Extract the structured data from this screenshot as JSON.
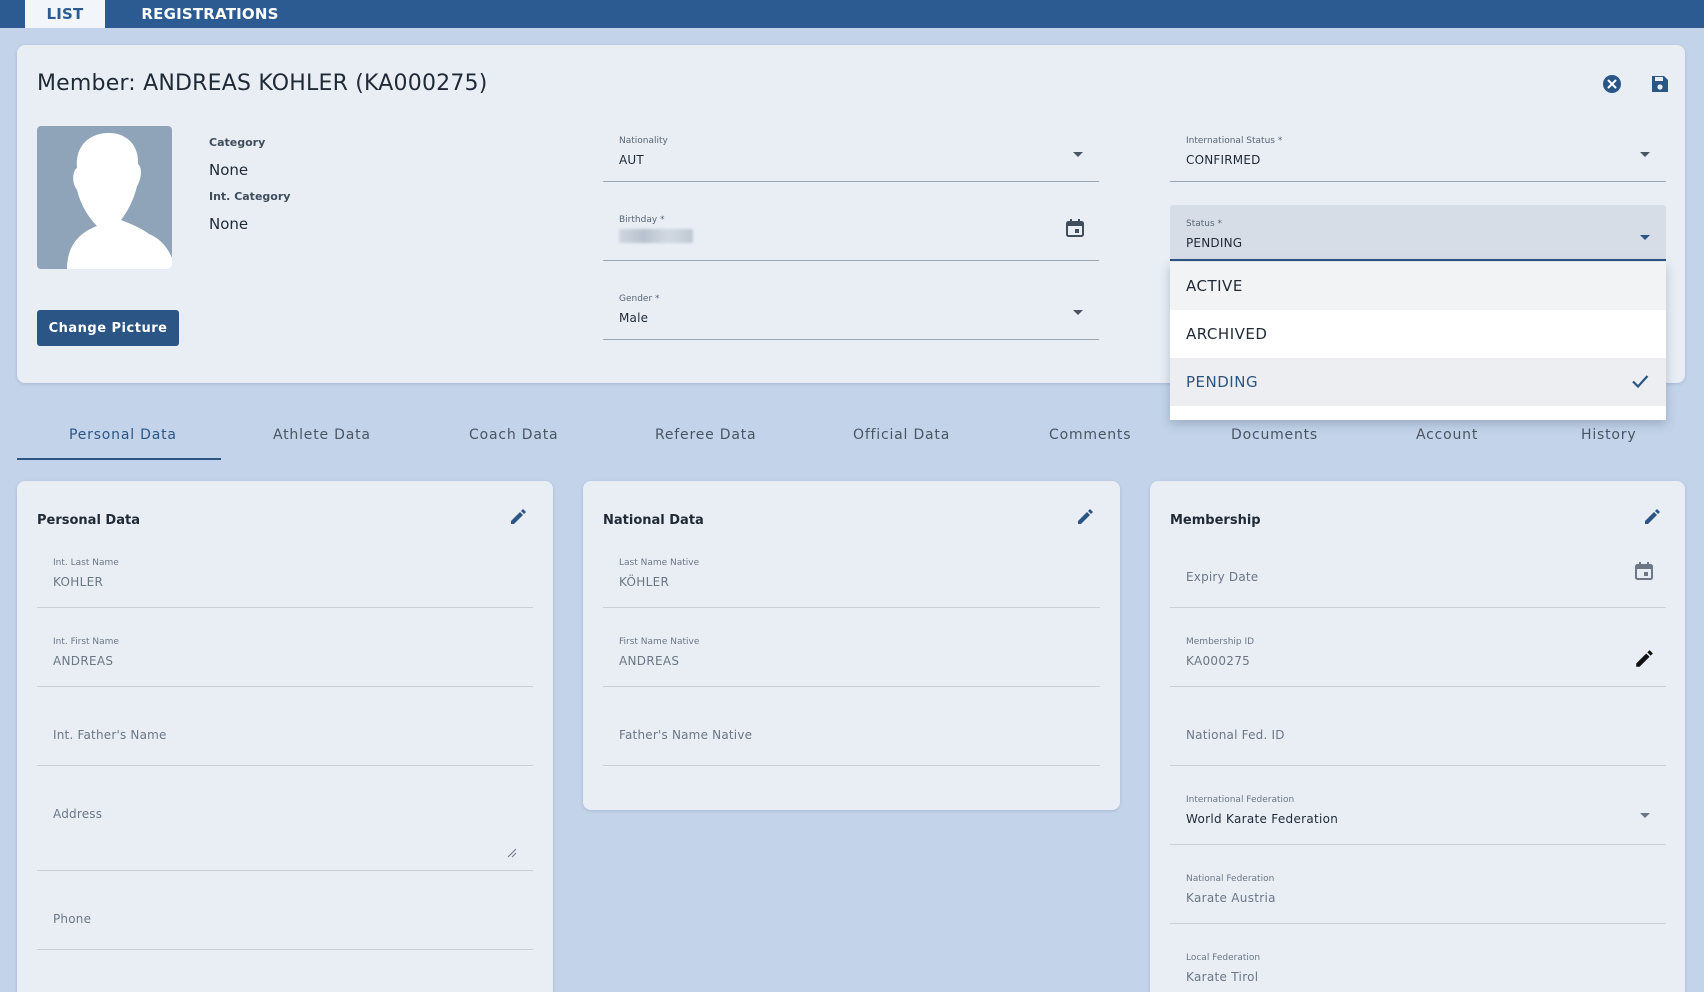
{
  "topnav": {
    "tabs": [
      {
        "label": "LIST"
      },
      {
        "label": "REGISTRATIONS"
      }
    ]
  },
  "member": {
    "title": "Member: ANDREAS KOHLER (KA000275)",
    "change_picture": "Change Picture",
    "category_label": "Category",
    "category_value": "None",
    "int_category_label": "Int. Category",
    "int_category_value": "None"
  },
  "fields": {
    "nationality": {
      "label": "Nationality",
      "value": "AUT"
    },
    "birthday": {
      "label": "Birthday *"
    },
    "gender": {
      "label": "Gender *",
      "value": "Male"
    },
    "int_status": {
      "label": "International Status *",
      "value": "CONFIRMED"
    },
    "status": {
      "label": "Status *",
      "value": "PENDING"
    }
  },
  "status_dropdown": {
    "options": [
      "ACTIVE",
      "ARCHIVED",
      "PENDING"
    ],
    "selected": "PENDING"
  },
  "section_tabs": [
    "Personal Data",
    "Athlete Data",
    "Coach Data",
    "Referee Data",
    "Official Data",
    "Comments",
    "Documents",
    "Account",
    "History"
  ],
  "personal_data": {
    "title": "Personal Data",
    "int_last_name": {
      "label": "Int. Last Name",
      "value": "KOHLER"
    },
    "int_first_name": {
      "label": "Int. First Name",
      "value": "ANDREAS"
    },
    "int_father_name": {
      "placeholder": "Int. Father's Name"
    },
    "address": {
      "placeholder": "Address"
    },
    "phone": {
      "placeholder": "Phone"
    }
  },
  "national_data": {
    "title": "National Data",
    "last_name_native": {
      "label": "Last Name Native",
      "value": "KÖHLER"
    },
    "first_name_native": {
      "label": "First Name Native",
      "value": "ANDREAS"
    },
    "father_name_native": {
      "placeholder": "Father's Name Native"
    }
  },
  "membership": {
    "title": "Membership",
    "expiry_date": {
      "placeholder": "Expiry Date"
    },
    "membership_id": {
      "label": "Membership ID",
      "value": "KA000275"
    },
    "national_fed_id": {
      "placeholder": "National Fed. ID"
    },
    "international_federation": {
      "label": "International Federation",
      "value": "World Karate Federation"
    },
    "national_federation": {
      "label": "National Federation",
      "value": "Karate Austria"
    },
    "local_federation": {
      "label": "Local Federation",
      "value": "Karate Tirol"
    }
  },
  "colors": {
    "topbar": "#2b5b91",
    "primary": "#2b5585",
    "background": "#c3d4ea",
    "card": "#e9eef5"
  },
  "icons": [
    "close-circle-icon",
    "save-icon",
    "calendar-icon",
    "pencil-icon",
    "check-icon",
    "avatar-silhouette-icon"
  ]
}
